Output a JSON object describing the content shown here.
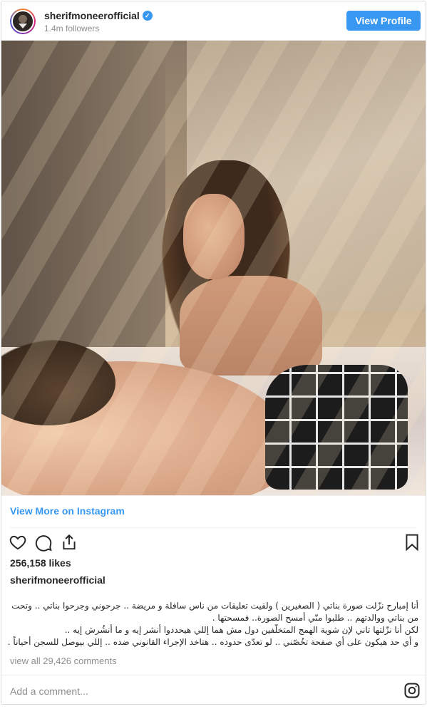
{
  "header": {
    "username": "sherifmoneerofficial",
    "verified_mark": "✓",
    "followers": "1.4m followers",
    "view_profile_label": "View Profile"
  },
  "post": {
    "view_more_label": "View More on Instagram",
    "likes": "256,158 likes",
    "caption_user": "sherifmoneerofficial",
    "caption_lines": [
      "أنا إمبارح نزّلت صورة بناتي ( الصغيرين ) ولقيت تعليقات من ناس سافلة و مريضة .. جرحوني وجرحوا بناتي .. وتحت ضغط",
      "من بناتي ووالدتهم .. طلبوا منّي أمسح الصورة.. فمسحتها .",
      "لكن أنا نزّلتها تاني لإن شوية الهمج المتخلّفين دول مش هما إللي هيحددوا أنشر إيه و ما أنشُرش إيه ..",
      "و أي حد هيكون على أي صفحة تخُصّني .. لو تعدّى حدوده .. هتاخد الإجراء القانوني ضده .. إللي بيوصل للسجن أحياناً ."
    ],
    "view_comments": "view all 29,426 comments",
    "comment_placeholder": "Add a comment..."
  },
  "icons": {
    "like": "heart-icon",
    "comment": "comment-icon",
    "share": "share-icon",
    "save": "bookmark-icon",
    "brand": "instagram-icon"
  },
  "colors": {
    "accent": "#3897f0",
    "text": "#262626",
    "muted": "#8e8e8e",
    "border": "#dbdbdb"
  }
}
